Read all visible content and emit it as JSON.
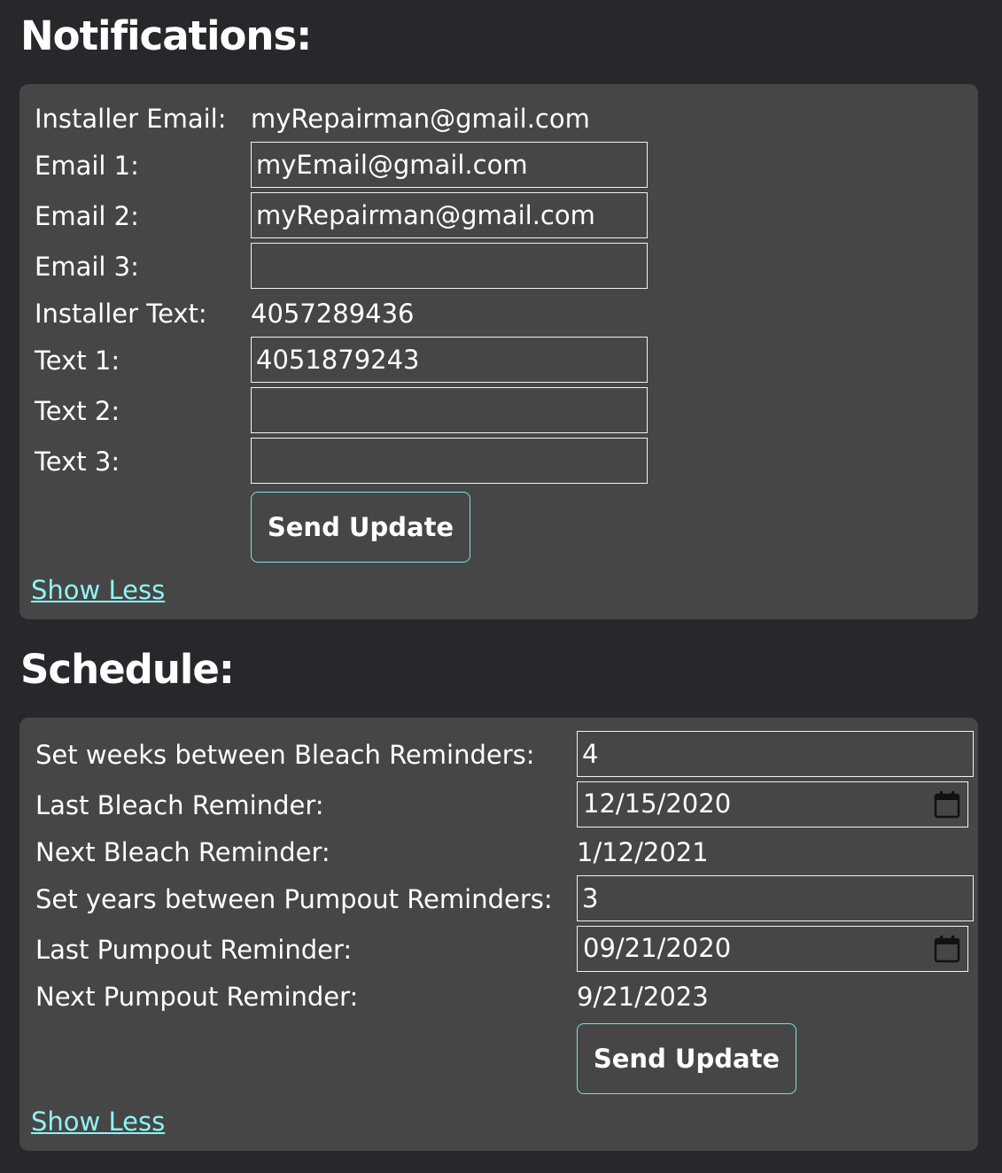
{
  "notifications": {
    "title": "Notifications:",
    "installer_email_label": "Installer Email:",
    "installer_email_value": "myRepairman@gmail.com",
    "email1_label": "Email 1:",
    "email1_value": "myEmail@gmail.com",
    "email2_label": "Email 2:",
    "email2_value": "myRepairman@gmail.com",
    "email3_label": "Email 3:",
    "email3_value": "",
    "installer_text_label": "Installer Text:",
    "installer_text_value": "4057289436",
    "text1_label": "Text 1:",
    "text1_value": "4051879243",
    "text2_label": "Text 2:",
    "text2_value": "",
    "text3_label": "Text 3:",
    "text3_value": "",
    "send_button": "Send Update",
    "toggle_link": "Show Less"
  },
  "schedule": {
    "title": "Schedule:",
    "bleach_weeks_label": "Set weeks between Bleach Reminders:",
    "bleach_weeks_value": "4",
    "last_bleach_label": "Last Bleach Reminder:",
    "last_bleach_value": "12/15/2020",
    "next_bleach_label": "Next Bleach Reminder:",
    "next_bleach_value": "1/12/2021",
    "pumpout_years_label": "Set years between Pumpout Reminders:",
    "pumpout_years_value": "3",
    "last_pumpout_label": "Last Pumpout Reminder:",
    "last_pumpout_value": "09/21/2020",
    "next_pumpout_label": "Next Pumpout Reminder:",
    "next_pumpout_value": "9/21/2023",
    "send_button": "Send Update",
    "toggle_link": "Show Less"
  },
  "icons": {
    "date_picker": "calendar-icon"
  },
  "colors": {
    "page_background": "#28272b",
    "panel_background": "#464646",
    "link": "#8ff3f3",
    "button_border": "#7fe0e0"
  }
}
